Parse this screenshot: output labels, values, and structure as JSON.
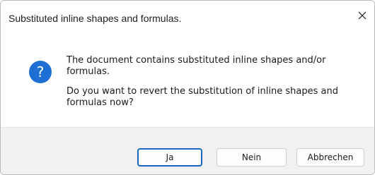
{
  "dialog": {
    "title": "Substituted inline shapes and formulas.",
    "close_icon": "close-icon",
    "message_icon": "question-icon",
    "message_line1": "The document contains substituted inline shapes and/or formulas.",
    "message_line2": "Do you want to revert the substitution of inline shapes and formulas now?",
    "buttons": {
      "yes": "Ja",
      "no": "Nein",
      "cancel": "Abbrechen"
    }
  },
  "colors": {
    "accent": "#1f68c0",
    "icon_blue": "#1e6fd3",
    "footer_bg": "#f1f1f1"
  }
}
